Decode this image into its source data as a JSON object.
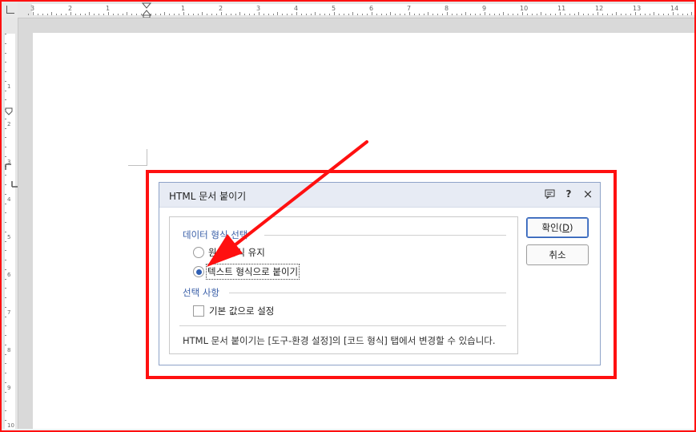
{
  "ruler": {
    "horizontal_numbers": [
      "3",
      "2",
      "1",
      "1",
      "2",
      "3",
      "4",
      "5",
      "6",
      "7",
      "8",
      "9",
      "10",
      "11",
      "12",
      "13",
      "14"
    ],
    "vertical_numbers": [
      "1",
      "2",
      "3",
      "4",
      "5",
      "6",
      "7",
      "8",
      "9",
      "10"
    ]
  },
  "dialog": {
    "title": "HTML 문서 붙이기",
    "icons": [
      "comment-icon",
      "help-icon",
      "close-icon"
    ],
    "help_glyph": "?",
    "close_glyph": "×",
    "group_format": "데이터 형식 선택",
    "option_keep_original": "원본 형식 유지",
    "option_text_paste": "텍스트 형식으로 붙이기",
    "selected_option": "텍스트 형식으로 붙이기",
    "group_options": "선택 사항",
    "checkbox_default": "기본 값으로 설정",
    "checkbox_default_checked": false,
    "note": "HTML 문서 붙이기는 [도구-환경 설정]의 [코드 형식] 탭에서 변경할 수 있습니다.",
    "ok_label_prefix": "확인(",
    "ok_label_key": "D",
    "ok_label_suffix": ")",
    "cancel_label": "취소"
  },
  "colors": {
    "highlight": "#ff1010",
    "accent": "#3a5fa8",
    "arrow": "#ff1010"
  }
}
